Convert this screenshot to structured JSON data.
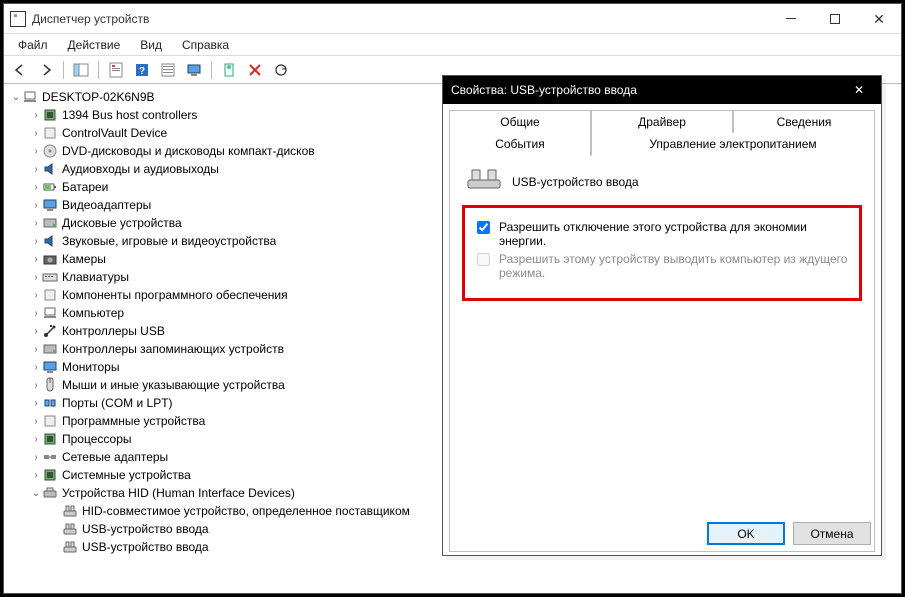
{
  "devmgr": {
    "title": "Диспетчер устройств",
    "menu": {
      "file": "Файл",
      "action": "Действие",
      "view": "Вид",
      "help": "Справка"
    },
    "root": "DESKTOP-02K6N9B",
    "cats": [
      {
        "label": "1394 Bus host controllers",
        "icon": "chip"
      },
      {
        "label": "ControlVault Device",
        "icon": "misc"
      },
      {
        "label": "DVD-дисководы и дисководы компакт-дисков",
        "icon": "disc"
      },
      {
        "label": "Аудиовходы и аудиовыходы",
        "icon": "audio"
      },
      {
        "label": "Батареи",
        "icon": "battery"
      },
      {
        "label": "Видеоадаптеры",
        "icon": "display"
      },
      {
        "label": "Дисковые устройства",
        "icon": "drive"
      },
      {
        "label": "Звуковые, игровые и видеоустройства",
        "icon": "audio"
      },
      {
        "label": "Камеры",
        "icon": "camera"
      },
      {
        "label": "Клавиатуры",
        "icon": "keyboard"
      },
      {
        "label": "Компоненты программного обеспечения",
        "icon": "sw"
      },
      {
        "label": "Компьютер",
        "icon": "computer"
      },
      {
        "label": "Контроллеры USB",
        "icon": "usb"
      },
      {
        "label": "Контроллеры запоминающих устройств",
        "icon": "storage"
      },
      {
        "label": "Мониторы",
        "icon": "monitor"
      },
      {
        "label": "Мыши и иные указывающие устройства",
        "icon": "mouse"
      },
      {
        "label": "Порты (COM и LPT)",
        "icon": "port"
      },
      {
        "label": "Программные устройства",
        "icon": "sw"
      },
      {
        "label": "Процессоры",
        "icon": "cpu"
      },
      {
        "label": "Сетевые адаптеры",
        "icon": "net"
      },
      {
        "label": "Системные устройства",
        "icon": "sys"
      }
    ],
    "hid": {
      "label": "Устройства HID (Human Interface Devices)",
      "children": [
        "HID-совместимое устройство, определенное поставщиком",
        "USB-устройство ввода",
        "USB-устройство ввода"
      ]
    }
  },
  "props": {
    "title": "Свойства: USB-устройство ввода",
    "tabs": {
      "general": "Общие",
      "driver": "Драйвер",
      "details": "Сведения",
      "events": "События",
      "power": "Управление электропитанием"
    },
    "device_name": "USB-устройство ввода",
    "check1_label": "Разрешить отключение этого устройства для экономии энергии.",
    "check1_value": true,
    "check2_label": "Разрешить этому устройству выводить компьютер из ждущего режима.",
    "check2_value": false,
    "check2_enabled": false,
    "ok": "OK",
    "cancel": "Отмена"
  }
}
